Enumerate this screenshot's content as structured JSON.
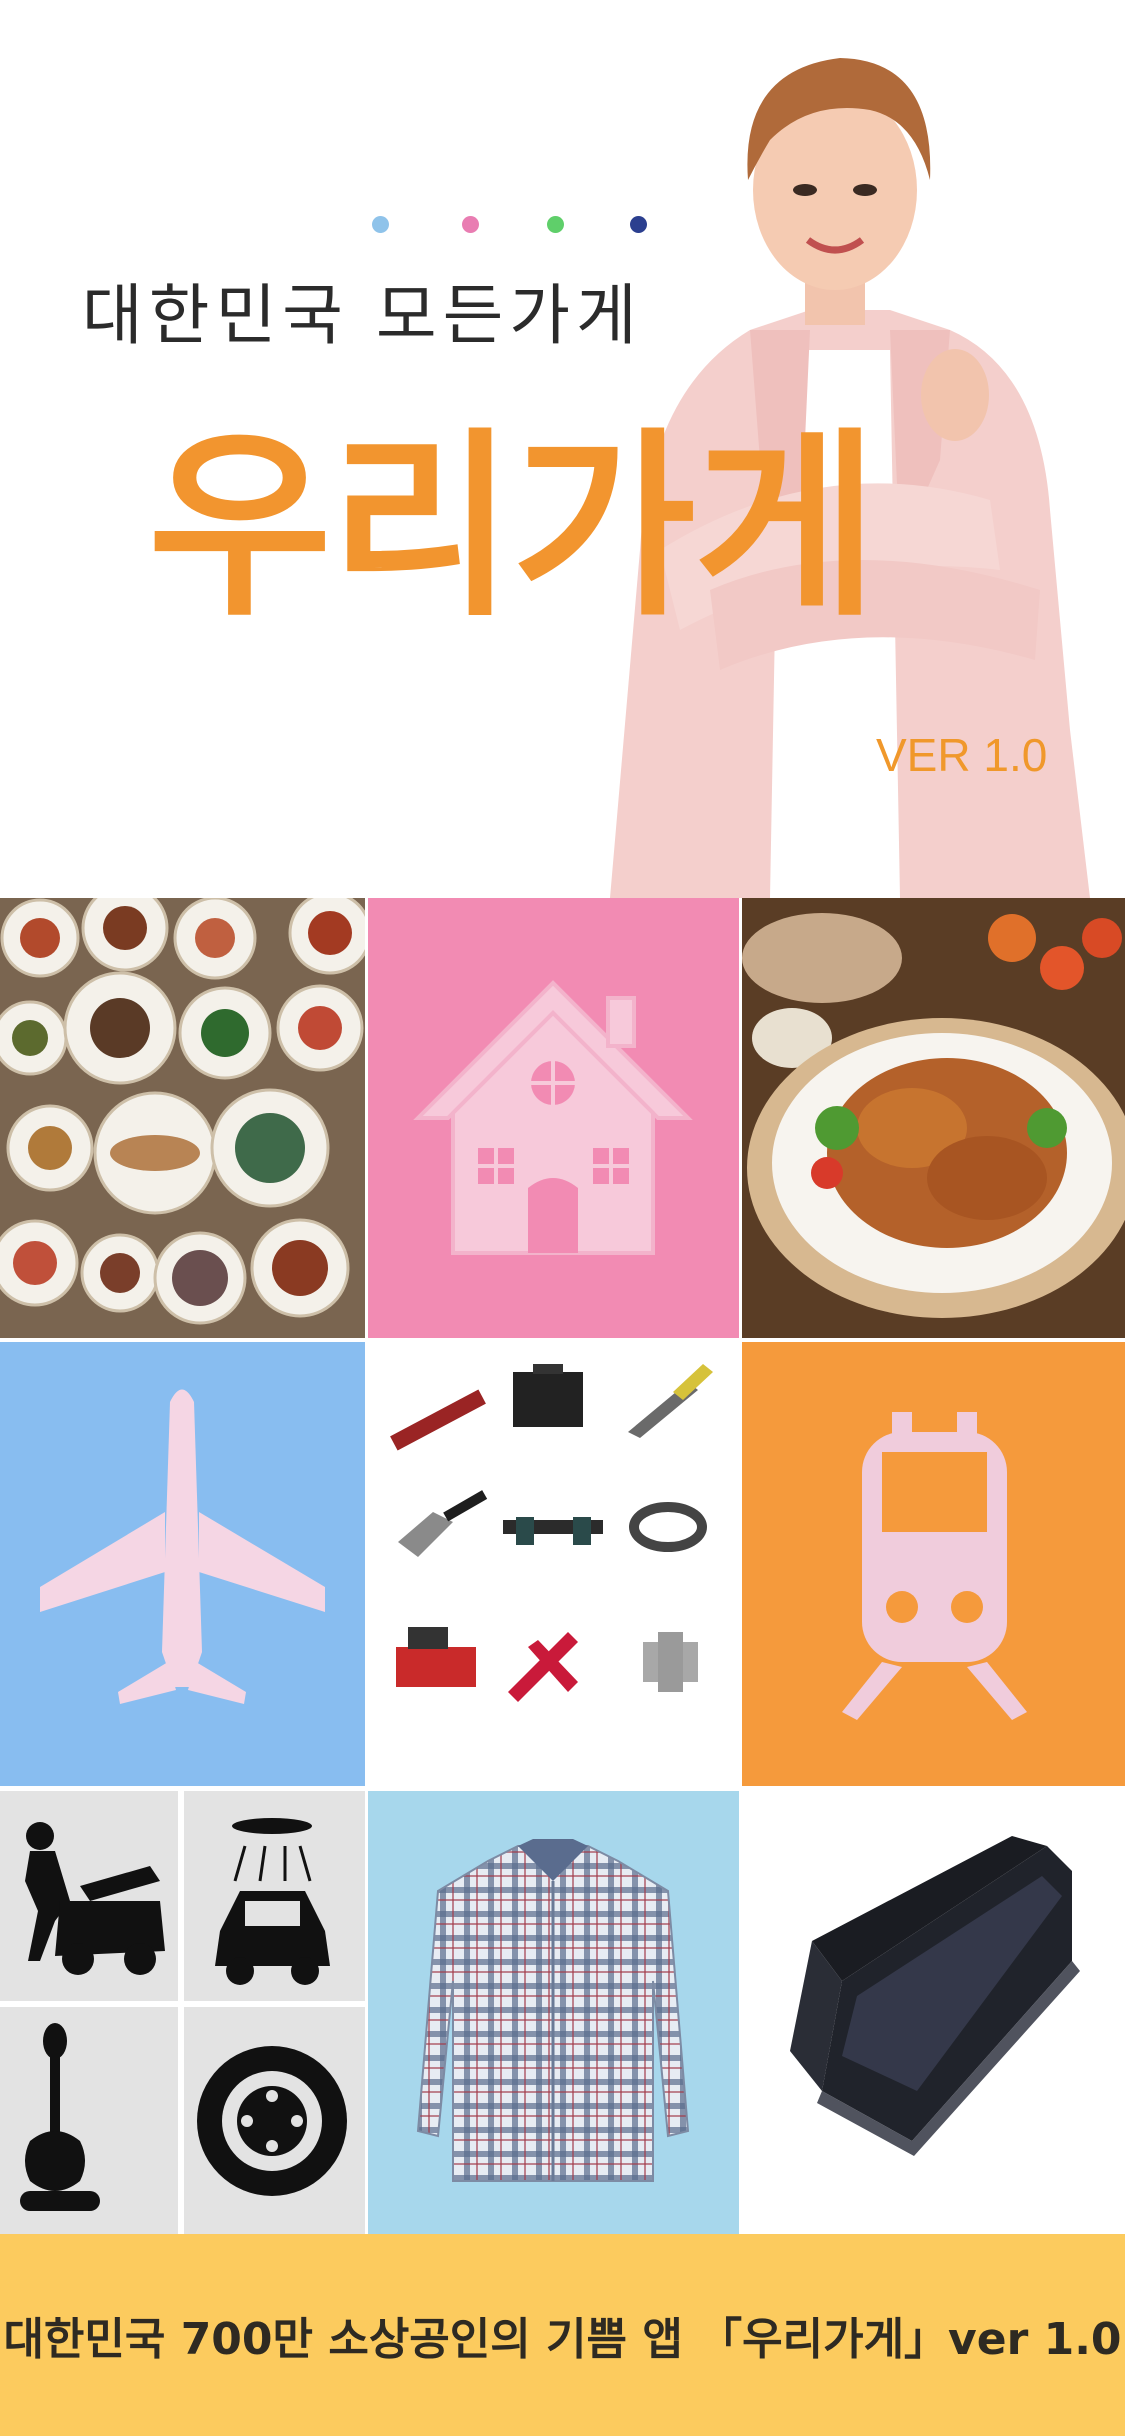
{
  "hero": {
    "subtitle": "대한민국 모든가게",
    "title": "우리가게",
    "version": "VER 1.0",
    "dot_colors": [
      "#8fc3ea",
      "#e97db2",
      "#5fcf6a",
      "#2b3f8f"
    ],
    "accent_color": "#f2952f"
  },
  "tiles": [
    {
      "name": "korean-food-table-photo"
    },
    {
      "name": "house-icon",
      "bg": "#f28bb3"
    },
    {
      "name": "fried-chicken-photo"
    },
    {
      "name": "airplane-icon",
      "bg": "#88bdf0"
    },
    {
      "name": "tools-collage"
    },
    {
      "name": "train-icon",
      "bg": "#f59a3c"
    },
    {
      "name": "car-service-icons"
    },
    {
      "name": "plaid-shirt-photo",
      "bg": "#a7d7ec"
    },
    {
      "name": "laptop-photo"
    }
  ],
  "footer": {
    "text": "대한민국 700만 소상공인의 기쁨 앱 「우리가게」ver 1.0",
    "bg": "#fccb5e"
  }
}
